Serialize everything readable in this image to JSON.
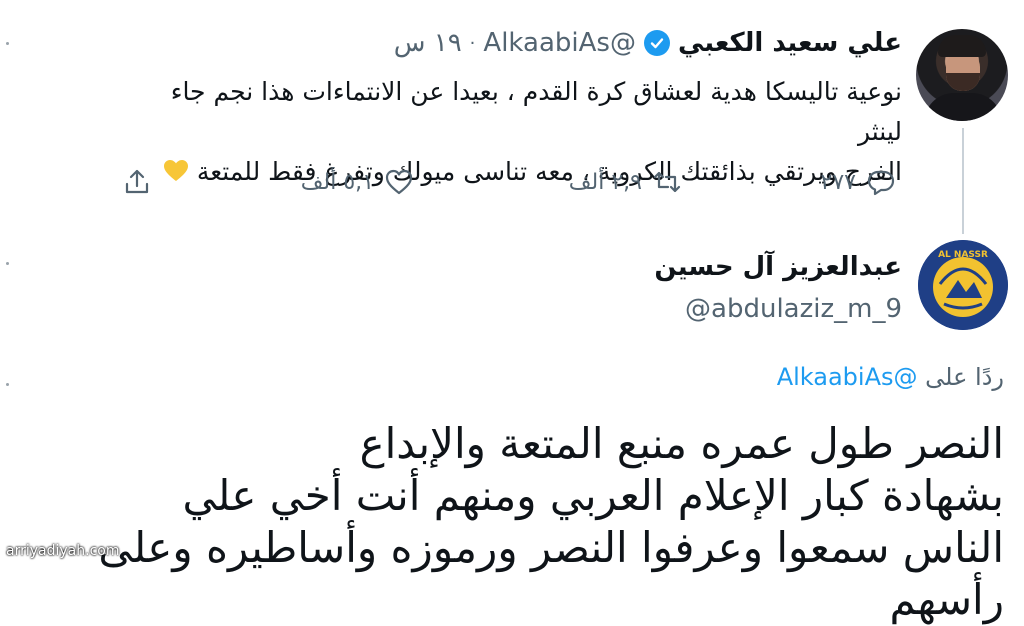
{
  "tweet1": {
    "display_name": "علي سعيد الكعبي",
    "handle": "@AlkaabiAs",
    "separator": "·",
    "time": "١٩ س",
    "text_line1": "نوعية تاليسكا هدية لعشاق كرة القدم ، بعيدا عن الانتماءات هذا نجم جاء لينثر",
    "text_line2": "الفرح ويرتقي بذائقتك الكروية ، معه تناسى ميولك وتفرغ فقط للمتعة",
    "reply_count": "٢٧٧",
    "retweet_count": "٢,٩ ألف",
    "like_count": "٥,١ ألف",
    "emoji": "yellow-heart",
    "accent": "#1d9bf0"
  },
  "tweet2": {
    "display_name": "عبدالعزيز آل حسين",
    "handle": "@abdulaziz_m_9",
    "reply_prefix": "ردًا على",
    "reply_mention": "@AlkaabiAs",
    "text_line1": "النصر طول عمره منبع المتعة والإبداع",
    "text_line2": "بشهادة كبار الإعلام العربي ومنهم أنت أخي علي",
    "text_line3": "الناس سمعوا وعرفوا النصر ورموزه وأساطيره وعلى رأسهم",
    "avatar_logo_text": "AL NASSR"
  },
  "watermark": "arriyadiyah.com"
}
